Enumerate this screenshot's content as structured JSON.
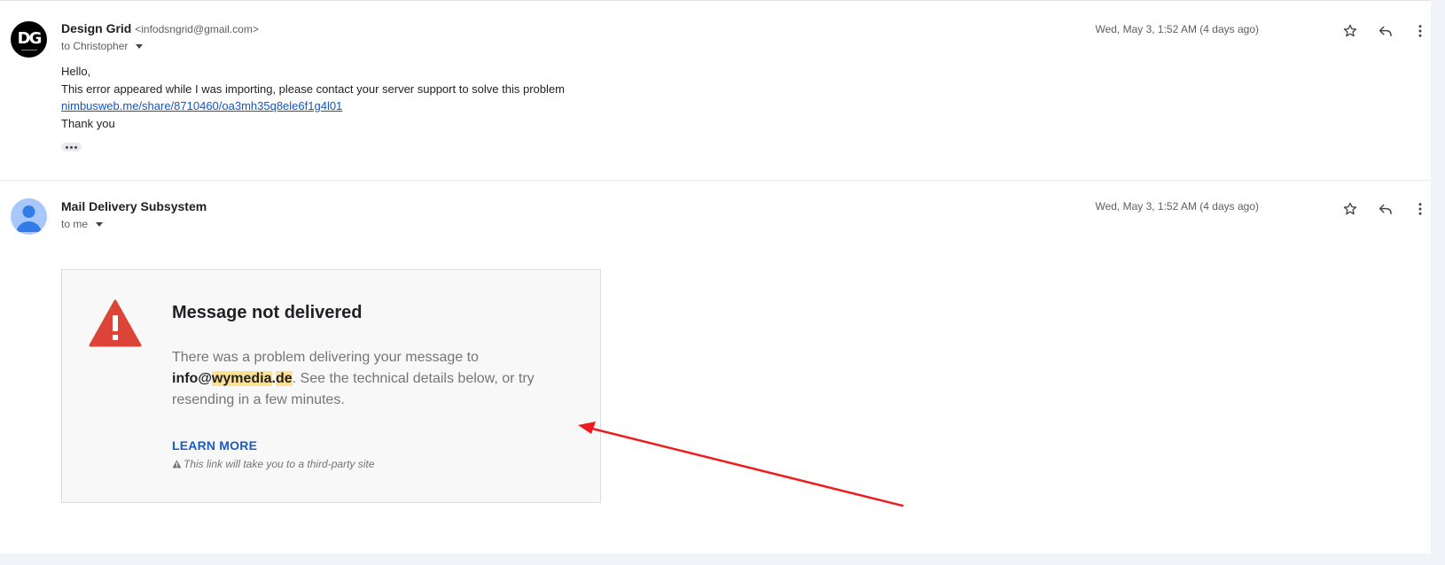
{
  "messages": [
    {
      "sender_name": "Design Grid",
      "sender_email": "<infodsngrid@gmail.com>",
      "to_label": "to Christopher",
      "date": "Wed, May 3, 1:52 AM (4 days ago)",
      "avatar_text": "DG",
      "body": {
        "greeting": "Hello,",
        "line1": "This error appeared while I was importing, please contact your server support to solve this problem",
        "link": "nimbusweb.me/share/8710460/oa3mh35q8ele6f1g4l01",
        "closing": "Thank you"
      }
    },
    {
      "sender_name": "Mail Delivery Subsystem",
      "to_label": "to me",
      "date": "Wed, May 3, 1:52 AM (4 days ago)",
      "ndr": {
        "title": "Message not delivered",
        "desc_before": "There was a problem delivering your message to",
        "addr_user": "info@",
        "addr_domain1": "wymedia",
        "addr_dot": ".",
        "addr_domain2": "de",
        "desc_after": ". See the technical details below, or try resending in a few minutes.",
        "learn_more": "LEARN MORE",
        "third_party": "This link will take you to a third-party site"
      }
    }
  ],
  "icons": {
    "star": "star-icon",
    "reply": "reply-icon",
    "more": "more-vert-icon",
    "caret": "chevron-down-icon",
    "warning": "warning-icon",
    "person": "person-icon"
  },
  "colors": {
    "link": "#1155cc",
    "learn_more": "#1a5cc4",
    "warning_red": "#db4437",
    "highlight": "#fde293",
    "annotation_arrow": "#ee1c1c"
  }
}
